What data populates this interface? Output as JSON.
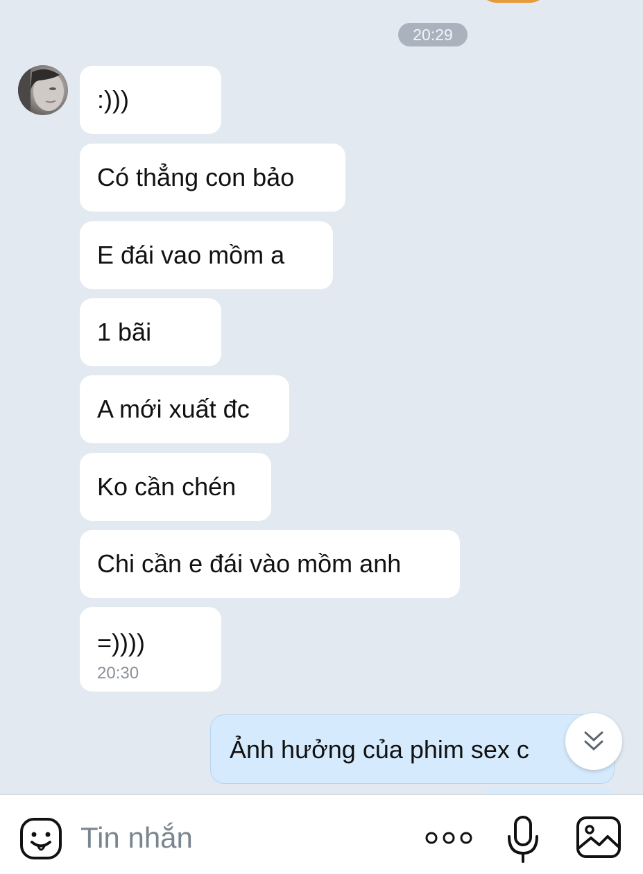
{
  "header": {
    "time_divider": "20:29"
  },
  "messages": [
    {
      "text": ":)))"
    },
    {
      "text": " Có thẳng con bảo"
    },
    {
      "text": "E đái vao mồm a"
    },
    {
      "text": "1 bãi"
    },
    {
      "text": "A mới xuất đc"
    },
    {
      "text": "Ko cần chén"
    },
    {
      "text": "Chi cần e đái vào mồm anh"
    },
    {
      "text": "=))))",
      "time": "20:30"
    }
  ],
  "outgoing": {
    "text": "Ảnh hưởng của phim sex c"
  },
  "composer": {
    "placeholder": "Tin nhắn"
  },
  "icons": {
    "emoji": "emoji-icon",
    "more": "more-options-icon",
    "mic": "microphone-icon",
    "image": "image-icon",
    "scroll": "scroll-down-icon",
    "avatar": "avatar"
  },
  "colors": {
    "background": "#e2e9f1",
    "incoming_bubble": "#ffffff",
    "outgoing_bubble": "#d5eafd",
    "time_pill": "#aab3bd"
  }
}
